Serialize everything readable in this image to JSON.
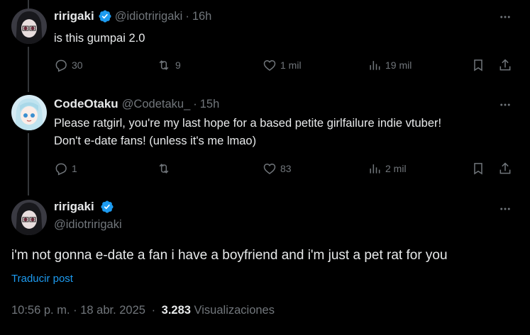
{
  "tweets": [
    {
      "name": "ririgaki",
      "handle": "@idiotririgaki",
      "time": "16h",
      "text": "is this gumpai 2.0",
      "replies": "30",
      "reposts": "9",
      "likes": "1 mil",
      "views": "19 mil"
    },
    {
      "name": "CodeOtaku",
      "handle": "@Codetaku_",
      "time": "15h",
      "text_line1": "Please ratgirl, you're my last hope for a based petite girlfailure indie vtuber!",
      "text_line2": "Don't e-date fans! (unless it's me lmao)",
      "replies": "1",
      "reposts": "",
      "likes": "83",
      "views": "2 mil"
    }
  ],
  "main": {
    "name": "ririgaki",
    "handle": "@idiotririgaki",
    "text": "i'm not gonna e-date a fan i have a boyfriend and i'm just a pet rat for you",
    "translate": "Traducir post",
    "timestamp": "10:56 p. m. · 18 abr. 2025",
    "sep": "·",
    "views_count": "3.283",
    "views_label": "Visualizaciones"
  },
  "colors": {
    "accent": "#1d9bf0",
    "muted": "#71767b",
    "text": "#e7e9ea",
    "background": "#000000"
  },
  "icons": [
    "reply-icon",
    "repost-icon",
    "like-icon",
    "views-icon",
    "bookmark-icon",
    "share-icon",
    "more-icon",
    "verified-icon"
  ]
}
